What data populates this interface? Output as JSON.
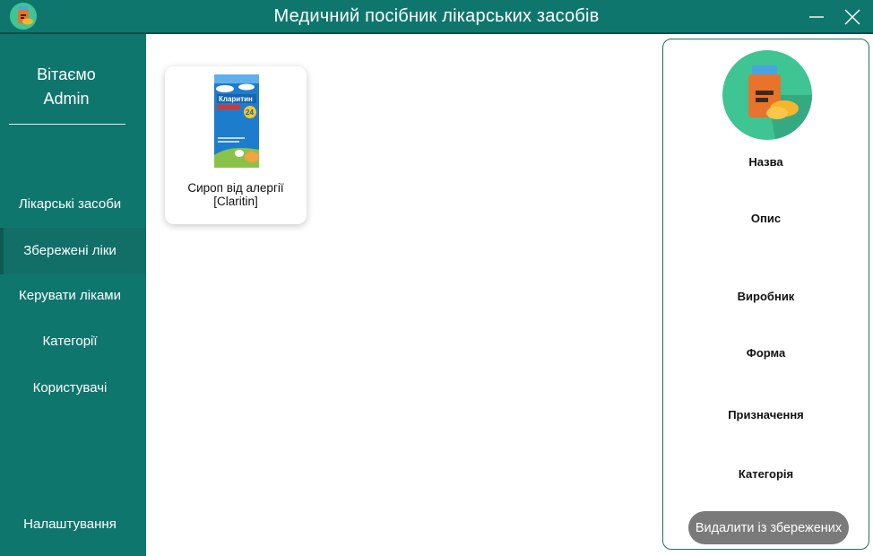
{
  "window": {
    "title": "Медичний посібник лікарських засобів",
    "icons": {
      "app": "pill-bottle-logo-icon",
      "minimize": "minimize-icon",
      "close": "close-icon"
    }
  },
  "sidebar": {
    "welcome_line1": "Вітаємо",
    "welcome_line2": "Admin",
    "items": [
      {
        "label": "Лікарські засоби"
      },
      {
        "label": "Збережені ліки",
        "active": true
      },
      {
        "label": "Керувати ліками"
      },
      {
        "label": "Категорії"
      },
      {
        "label": "Користувачі"
      }
    ],
    "settings_label": "Налаштування"
  },
  "main": {
    "saved_drugs": [
      {
        "name": "Сироп від алергії [Claritin]",
        "package_brand": "Кларитин",
        "package_dose": "24"
      }
    ]
  },
  "detail": {
    "labels": {
      "name": "Назва",
      "description": "Опис",
      "manufacturer": "Виробник",
      "form": "Форма",
      "purpose": "Призначення",
      "category": "Категорія"
    },
    "remove_button": "Видалити із збережених"
  },
  "colors": {
    "primary": "#0f766e",
    "button_gray": "#7a7a7a",
    "logo_circle": "#3fc493"
  }
}
